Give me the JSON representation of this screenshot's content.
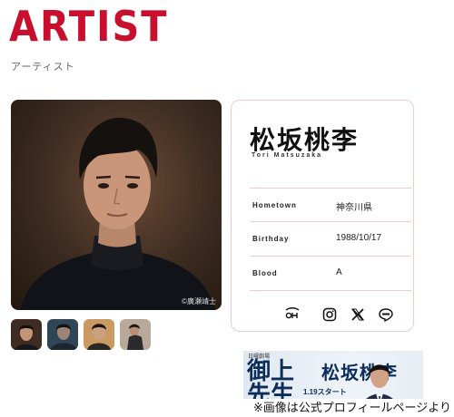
{
  "header": {
    "title": "ARTIST",
    "subtitle": "アーティスト"
  },
  "photo": {
    "credit": "©廣瀬靖士"
  },
  "thumbnails": [
    "thumb-1",
    "thumb-2",
    "thumb-3",
    "thumb-4"
  ],
  "profile": {
    "name_jp": "松坂桃李",
    "name_en": "Tori Matsuzaka",
    "rows": [
      {
        "label": "Hometown",
        "value": "神奈川県"
      },
      {
        "label": "Birthday",
        "value": "1988/10/17"
      },
      {
        "label": "Blood",
        "value": "A"
      }
    ],
    "social": [
      "fanclub-icon",
      "instagram-icon",
      "x-icon",
      "line-icon"
    ]
  },
  "banner": {
    "small": "日曜劇場",
    "drama": "御上\n先生",
    "date": "1.19スタート",
    "name": "松坂桃李"
  },
  "caption": "※画像は公式プロフィールページより",
  "colors": {
    "brand_red": "#c8102e",
    "card_border": "#f1c9cf",
    "banner_navy": "#0c2d5a"
  }
}
